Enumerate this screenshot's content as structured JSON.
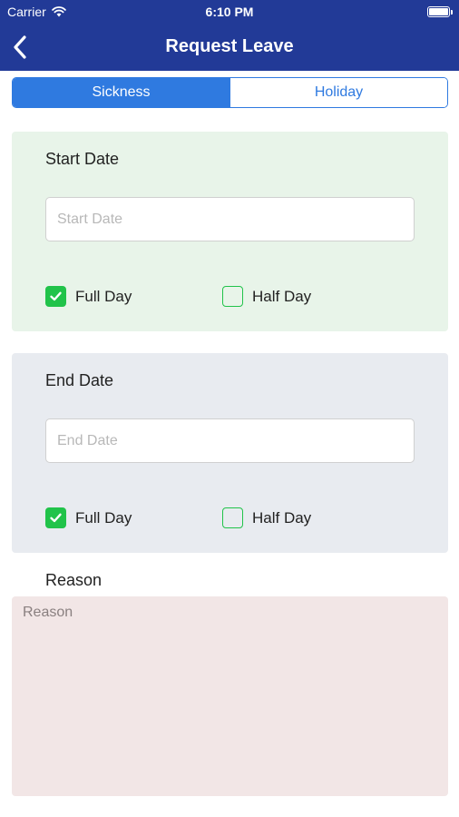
{
  "status_bar": {
    "carrier": "Carrier",
    "time": "6:10 PM"
  },
  "nav": {
    "title": "Request Leave",
    "back_icon": "chevron-left-icon"
  },
  "tabs": [
    {
      "label": "Sickness",
      "active": true
    },
    {
      "label": "Holiday",
      "active": false
    }
  ],
  "start_section": {
    "label": "Start Date",
    "placeholder": "Start Date",
    "value": "",
    "full_day_label": "Full Day",
    "full_day_checked": true,
    "half_day_label": "Half Day",
    "half_day_checked": false
  },
  "end_section": {
    "label": "End Date",
    "placeholder": "End Date",
    "value": "",
    "full_day_label": "Full Day",
    "full_day_checked": true,
    "half_day_label": "Half Day",
    "half_day_checked": false
  },
  "reason": {
    "label": "Reason",
    "placeholder": "Reason",
    "value": ""
  },
  "colors": {
    "nav_bar": "#223a97",
    "accent": "#2f7ae0",
    "checkbox": "#21c34a",
    "start_card_bg": "#e8f4e9",
    "end_card_bg": "#e8ebf0",
    "reason_bg": "#f2e6e6"
  }
}
